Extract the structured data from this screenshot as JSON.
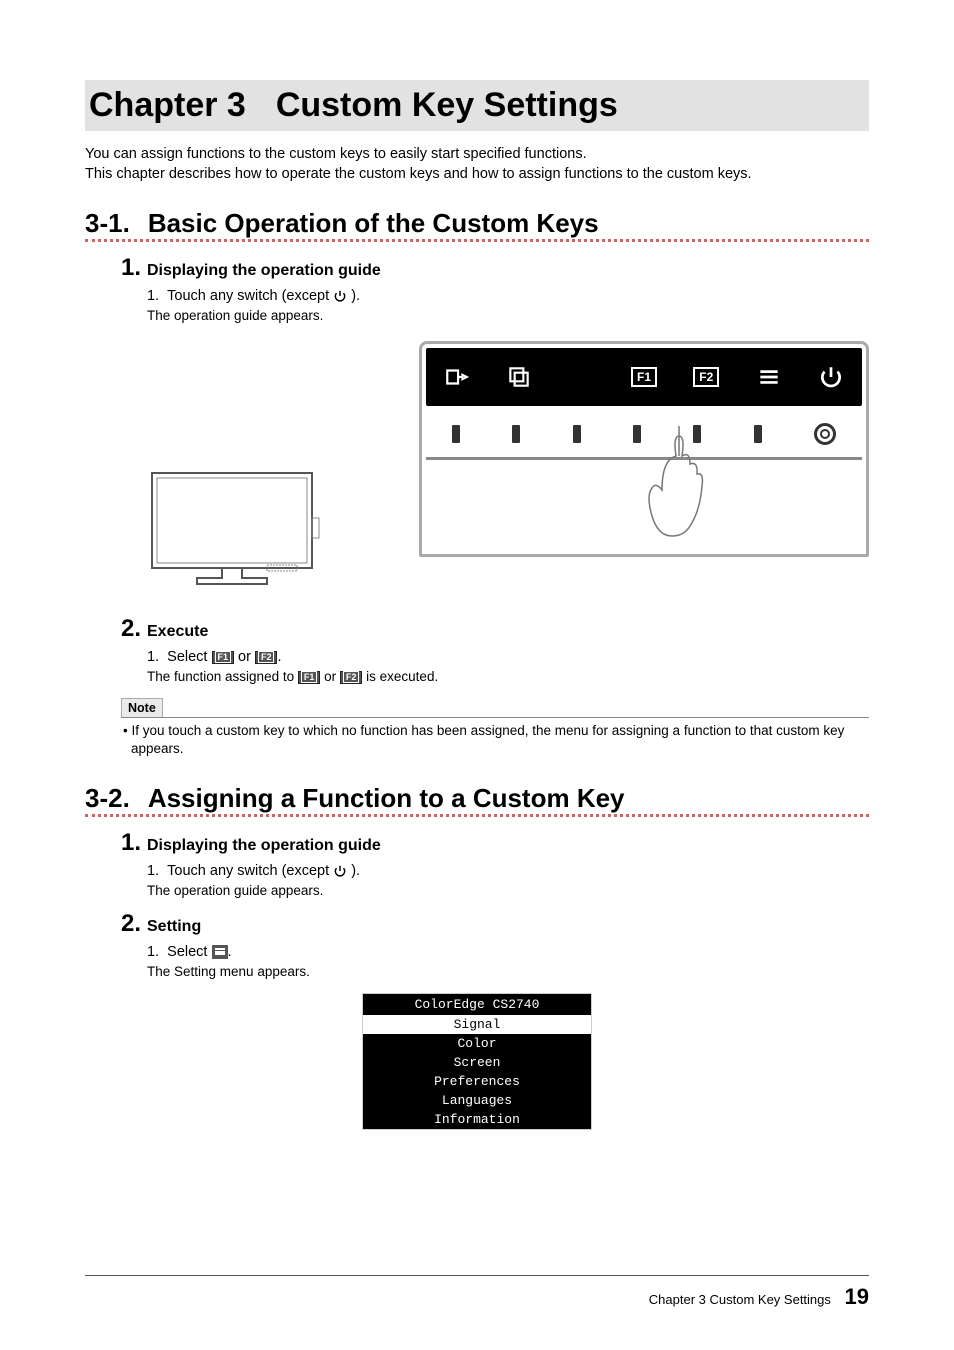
{
  "chapter": {
    "num": "Chapter 3",
    "title": "Custom Key Settings"
  },
  "intro": {
    "line1": "You can assign functions to the custom keys to easily start specified functions.",
    "line2": "This chapter describes how to operate the custom keys and how to assign functions to the custom keys."
  },
  "s1": {
    "num": "3-1.",
    "title": "Basic Operation of the Custom Keys",
    "step1": {
      "num": "1.",
      "title": "Displaying the operation guide",
      "sub_num": "1.",
      "sub_text": "Touch any switch (except ",
      "sub_text2": " ).",
      "result": "The operation guide appears."
    },
    "step2": {
      "num": "2.",
      "title": "Execute",
      "sub_num": "1.",
      "pre": "Select ",
      "mid": " or ",
      "post": ".",
      "result_pre": "The function assigned to ",
      "result_mid": " or ",
      "result_post": " is executed."
    },
    "osd_icons": [
      "signal",
      "window",
      "blank",
      "f1",
      "f2",
      "menu",
      "power"
    ],
    "note": {
      "label": "Note",
      "text": "If you touch a custom key to which no function has been assigned, the menu for assigning a function to that custom key appears.",
      "bullet": "• "
    }
  },
  "s2": {
    "num": "3-2.",
    "title": "Assigning a Function to a Custom Key",
    "step1": {
      "num": "1.",
      "title": "Displaying the operation guide",
      "sub_num": "1.",
      "sub_text": "Touch any switch (except ",
      "sub_text2": " ).",
      "result": "The operation guide appears."
    },
    "step2": {
      "num": "2.",
      "title": "Setting",
      "sub_num": "1.",
      "pre": "Select ",
      "post": ".",
      "result": "The Setting menu appears."
    },
    "menu": {
      "title": "ColorEdge CS2740",
      "selected": "Signal",
      "items": [
        "Color",
        "Screen",
        "Preferences",
        "Languages",
        "Information"
      ]
    }
  },
  "footer": {
    "chapter": "Chapter 3   Custom Key Settings",
    "page": "19"
  }
}
